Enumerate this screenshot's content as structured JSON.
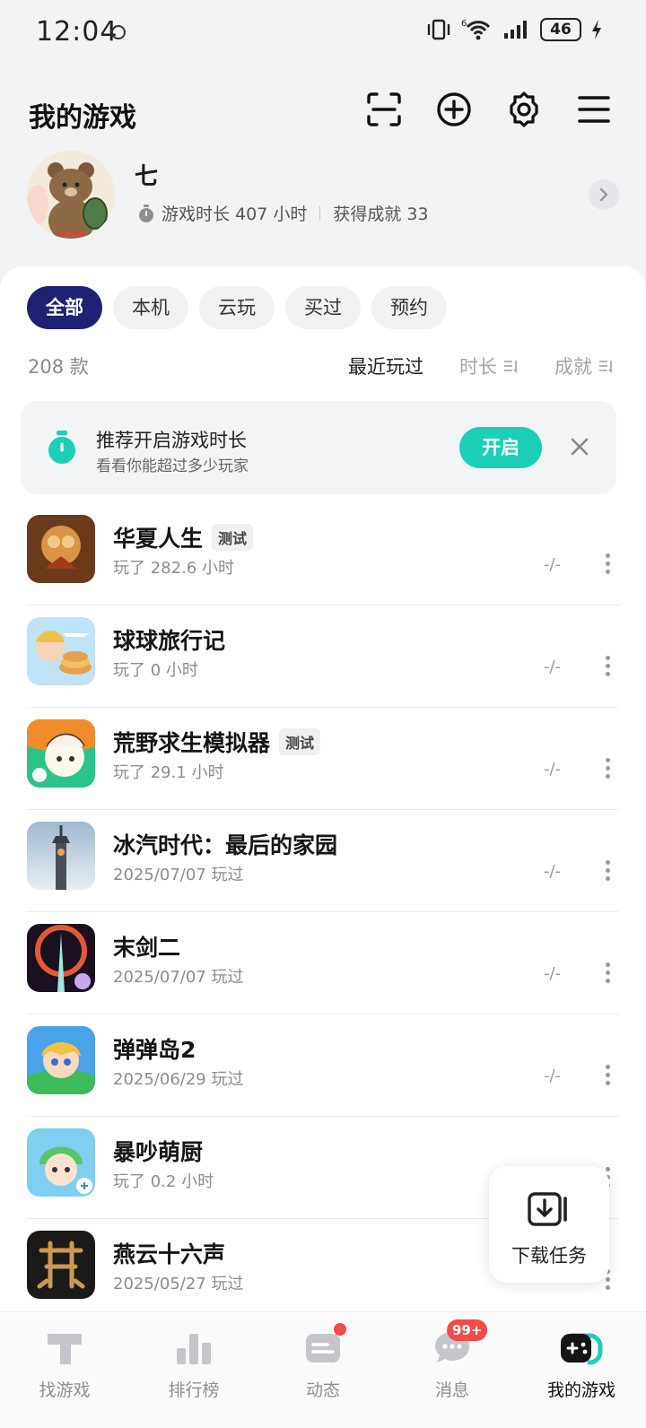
{
  "status_bar": {
    "time": "12:04",
    "battery": "46",
    "network_sup": "6"
  },
  "header": {
    "title": "我的游戏"
  },
  "profile": {
    "name": "七",
    "playtime": "游戏时长 407 小时",
    "achievements": "获得成就 33"
  },
  "filters": [
    {
      "label": "全部",
      "active": true
    },
    {
      "label": "本机",
      "active": false
    },
    {
      "label": "云玩",
      "active": false
    },
    {
      "label": "买过",
      "active": false
    },
    {
      "label": "预约",
      "active": false
    }
  ],
  "list_header": {
    "count": "208 款",
    "sort_recent": "最近玩过",
    "sort_duration": "时长",
    "sort_achievement": "成就"
  },
  "banner": {
    "title": "推荐开启游戏时长",
    "subtitle": "看看你能超过多少玩家",
    "button": "开启"
  },
  "games": [
    {
      "name": "华夏人生",
      "tag": "测试",
      "meta": "玩了 282.6 小时",
      "score": "-/-"
    },
    {
      "name": "球球旅行记",
      "tag": "",
      "meta": "玩了 0 小时",
      "score": "-/-"
    },
    {
      "name": "荒野求生模拟器",
      "tag": "测试",
      "meta": "玩了 29.1 小时",
      "score": "-/-"
    },
    {
      "name": "冰汽时代：最后的家园",
      "tag": "",
      "meta": "2025/07/07 玩过",
      "score": "-/-"
    },
    {
      "name": "末剑二",
      "tag": "",
      "meta": "2025/07/07 玩过",
      "score": "-/-"
    },
    {
      "name": "弹弹岛2",
      "tag": "",
      "meta": "2025/06/29 玩过",
      "score": "-/-"
    },
    {
      "name": "暴吵萌厨",
      "tag": "",
      "meta": "玩了 0.2 小时",
      "score": ""
    },
    {
      "name": "燕云十六声",
      "tag": "",
      "meta": "2025/05/27 玩过",
      "score": ""
    }
  ],
  "download_task": {
    "label": "下载任务"
  },
  "tabs": [
    {
      "label": "找游戏",
      "icon": "find-game-icon"
    },
    {
      "label": "排行榜",
      "icon": "ranking-icon"
    },
    {
      "label": "动态",
      "icon": "feed-icon"
    },
    {
      "label": "消息",
      "icon": "message-icon",
      "badge": "99+"
    },
    {
      "label": "我的游戏",
      "icon": "my-games-icon"
    }
  ],
  "colors": {
    "accent_dark": "#1f2172",
    "accent_teal": "#1ccfb7",
    "badge_red": "#f24b4b"
  }
}
